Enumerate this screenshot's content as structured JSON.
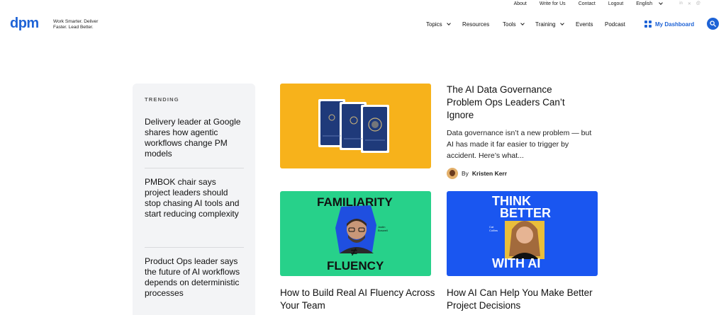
{
  "topbar": {
    "links": [
      "About",
      "Write for Us",
      "Contact",
      "Logout"
    ],
    "language": "English",
    "social_icons": [
      "linkedin-icon",
      "x-icon",
      "threads-icon"
    ]
  },
  "header": {
    "logo": "dpm",
    "tagline": "Work Smarter. Deliver Faster. Lead Better.",
    "nav": [
      {
        "label": "Topics",
        "has_dropdown": true
      },
      {
        "label": "Resources",
        "has_dropdown": false
      },
      {
        "label": "Tools",
        "has_dropdown": true
      },
      {
        "label": "Training",
        "has_dropdown": true
      },
      {
        "label": "Events",
        "has_dropdown": false
      },
      {
        "label": "Podcast",
        "has_dropdown": false
      }
    ],
    "dashboard_label": "My Dashboard"
  },
  "trending": {
    "heading": "TRENDING",
    "items": [
      "Delivery leader at Google shares how agentic workflows change PM models",
      "PMBOK chair says project leaders should stop chasing AI tools and start reducing complexity",
      "Product Ops leader says the future of AI workflows depends on deterministic processes"
    ]
  },
  "featured": {
    "title": "The AI Data Governance Problem Ops Leaders Can’t Ignore",
    "excerpt": "Data governance isn’t a new problem — but AI has made it far easier to trigger by accident. Here’s what...",
    "by_prefix": "By",
    "author": "Kristen Kerr"
  },
  "articles": [
    {
      "title": "How to Build Real AI Fluency Across Your Team",
      "image_text_top": "FAMILIARITY",
      "image_symbol": "≠",
      "image_text_bottom": "FLUENCY",
      "image_caption": "Justin Boswell"
    },
    {
      "title": "How AI Can Help You Make Better Project Decisions",
      "image_text_top": "THINK",
      "image_text_mid": "BETTER",
      "image_text_bottom": "WITH AI",
      "image_caption": "Cat Collins"
    }
  ],
  "colors": {
    "brand": "#1e63d6",
    "card1": "#f7b21b",
    "card2": "#27d18a",
    "card3": "#1a56f0",
    "sidebar_bg": "#f3f4f6"
  }
}
